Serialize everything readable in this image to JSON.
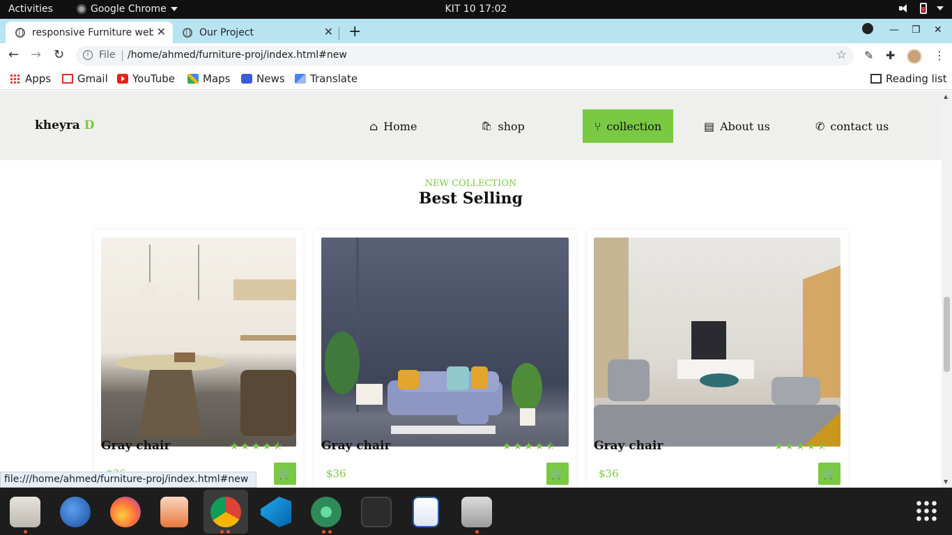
{
  "system_bar": {
    "activities": "Activities",
    "app_name": "Google Chrome",
    "clock": "KIT 10  17:02"
  },
  "browser": {
    "tabs": [
      {
        "title": "responsive Furniture web",
        "active": true
      },
      {
        "title": "Our Project",
        "active": false
      }
    ],
    "address": {
      "scheme_label": "File",
      "url": "/home/ahmed/furniture-proj/index.html#new"
    },
    "bookmarks": [
      {
        "label": "Apps",
        "icon": "apps-grid-icon"
      },
      {
        "label": "Gmail",
        "icon": "gmail-icon"
      },
      {
        "label": "YouTube",
        "icon": "youtube-icon"
      },
      {
        "label": "Maps",
        "icon": "maps-icon"
      },
      {
        "label": "News",
        "icon": "news-icon"
      },
      {
        "label": "Translate",
        "icon": "translate-icon"
      }
    ],
    "reading_list": "Reading list",
    "status_url": "file:///home/ahmed/furniture-proj/index.html#new"
  },
  "site": {
    "logo": {
      "text": "kheyra",
      "accent": "D"
    },
    "nav": [
      {
        "label": "Home",
        "icon": "home-icon",
        "glyph": "⌂"
      },
      {
        "label": "shop",
        "icon": "shopping-bag-icon",
        "glyph": "🛍"
      },
      {
        "label": "collection",
        "icon": "chair-icon",
        "glyph": "⑂",
        "active": true
      },
      {
        "label": "About us",
        "icon": "id-card-icon",
        "glyph": "▤"
      },
      {
        "label": "contact us",
        "icon": "phone-icon",
        "glyph": "✆"
      }
    ],
    "section": {
      "subtitle": "NEW COLLECTION",
      "title": "Best Selling"
    },
    "products": [
      {
        "name": "Gray chair",
        "price": "$36",
        "rating": 4.5
      },
      {
        "name": "Gray chair",
        "price": "$36",
        "rating": 4.5
      },
      {
        "name": "Gray chair",
        "price": "$36",
        "rating": 4.5
      }
    ],
    "colors": {
      "accent": "#7ac943",
      "header_bg": "#efefee"
    }
  }
}
